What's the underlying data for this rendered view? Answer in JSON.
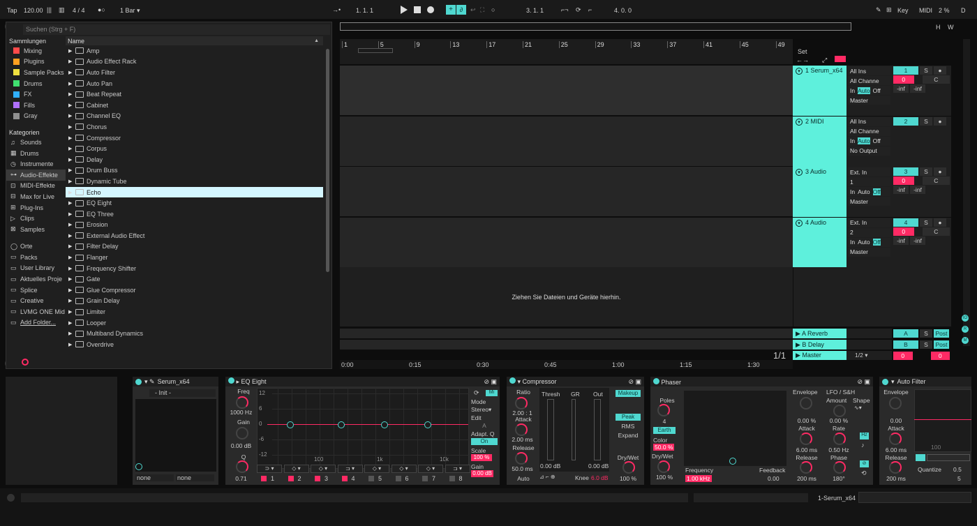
{
  "toolbar": {
    "tap": "Tap",
    "tempo": "120.00",
    "meter": "4 / 4",
    "quant": "1 Bar",
    "position": "1.   1.   1",
    "loop_start": "3.   1.   1",
    "loop_length": "4.   0.   0",
    "key": "Key",
    "midi": "MIDI",
    "cpu": "2 %",
    "d": "D",
    "h": "H",
    "w": "W"
  },
  "browser": {
    "search_placeholder": "Suchen (Strg + F)",
    "collections_title": "Sammlungen",
    "collections": [
      {
        "label": "Mixing",
        "color": "#ff4a4a"
      },
      {
        "label": "Plugins",
        "color": "#ffa020"
      },
      {
        "label": "Sample Packs",
        "color": "#f0e040"
      },
      {
        "label": "Drums",
        "color": "#40e070"
      },
      {
        "label": "FX",
        "color": "#30b0ff"
      },
      {
        "label": "Fills",
        "color": "#b070ff"
      },
      {
        "label": "Gray",
        "color": "#909090"
      }
    ],
    "categories_title": "Kategorien",
    "categories": [
      "Sounds",
      "Drums",
      "Instrumente",
      "Audio-Effekte",
      "MIDI-Effekte",
      "Max for Live",
      "Plug-Ins",
      "Clips",
      "Samples"
    ],
    "places_title": "Orte",
    "places": [
      "Packs",
      "User Library",
      "Aktuelles Proje",
      "Splice",
      "Creative",
      "LVMG ONE Mid",
      "Add Folder..."
    ],
    "list_header": "Name",
    "items": [
      "Amp",
      "Audio Effect Rack",
      "Auto Filter",
      "Auto Pan",
      "Beat Repeat",
      "Cabinet",
      "Channel EQ",
      "Chorus",
      "Compressor",
      "Corpus",
      "Delay",
      "Drum Buss",
      "Dynamic Tube",
      "Echo",
      "EQ Eight",
      "EQ Three",
      "Erosion",
      "External Audio Effect",
      "Filter Delay",
      "Flanger",
      "Frequency Shifter",
      "Gate",
      "Glue Compressor",
      "Grain Delay",
      "Limiter",
      "Looper",
      "Multiband Dynamics",
      "Overdrive"
    ]
  },
  "arrangement": {
    "bars": [
      "1",
      "5",
      "9",
      "13",
      "17",
      "21",
      "25",
      "29",
      "33",
      "37",
      "41",
      "45",
      "49"
    ],
    "times": [
      "0:00",
      "0:15",
      "0:30",
      "0:45",
      "1:00",
      "1:15",
      "1:30"
    ],
    "drop_hint": "Ziehen Sie Dateien und Geräte hierhin.",
    "set_label": "Set",
    "page": "1/1",
    "tracks": [
      {
        "name": "1 Serum_x64",
        "in": "All Ins",
        "ch": "All Channe",
        "mon_in": "In",
        "mon_auto": "Auto",
        "mon_off": "Off",
        "out": "Master",
        "num": "1",
        "vol": "0",
        "pan": "C",
        "peak1": "-inf",
        "peak2": "-inf"
      },
      {
        "name": "2 MIDI",
        "in": "All Ins",
        "ch": "All Channe",
        "mon_in": "In",
        "mon_auto": "Auto",
        "mon_off": "Off",
        "out": "No Output",
        "num": "2"
      },
      {
        "name": "3 Audio",
        "in": "Ext. In",
        "ch": "1",
        "mon_in": "In",
        "mon_auto": "Auto",
        "mon_off": "Off",
        "out": "Master",
        "num": "3",
        "vol": "0",
        "pan": "C",
        "peak1": "-inf",
        "peak2": "-inf"
      },
      {
        "name": "4 Audio",
        "in": "Ext. In",
        "ch": "2",
        "mon_in": "In",
        "mon_auto": "Auto",
        "mon_off": "Off",
        "out": "Master",
        "num": "4",
        "vol": "0",
        "pan": "C",
        "peak1": "-inf",
        "peak2": "-inf"
      }
    ],
    "returns": [
      {
        "name": "A Reverb",
        "btn": "A",
        "s": "S",
        "post": "Post"
      },
      {
        "name": "B Delay",
        "btn": "B",
        "s": "S",
        "post": "Post"
      }
    ],
    "master": {
      "name": "Master",
      "cue": "1/2",
      "vol": "0",
      "vol2": "0"
    }
  },
  "devices": {
    "serum": {
      "title": "Serum_x64",
      "preset": "- Init -",
      "left": "none",
      "right": "none"
    },
    "eq": {
      "title": "EQ Eight",
      "freq_label": "Freq",
      "freq": "1000 Hz",
      "gain_label": "Gain",
      "gain": "0.00 dB",
      "q_label": "Q",
      "q": "0.71",
      "db": [
        "12",
        "6",
        "0",
        "-6",
        "-12"
      ],
      "hz": [
        "100",
        "1k",
        "10k"
      ],
      "mode_label": "Mode",
      "mode": "Stereo",
      "edit": "Edit",
      "edit_val": "A",
      "adapt": "Adapt. Q",
      "adapt_val": "On",
      "scale": "Scale",
      "scale_val": "100 %",
      "gain2_label": "Gain",
      "gain2": "0.00 dB",
      "bands": [
        "1",
        "2",
        "3",
        "4",
        "5",
        "6",
        "7",
        "8"
      ],
      "mi": "Mi"
    },
    "comp": {
      "title": "Compressor",
      "ratio_label": "Ratio",
      "ratio": "2.00 : 1",
      "attack_label": "Attack",
      "attack": "2.00 ms",
      "release_label": "Release",
      "release": "50.0 ms",
      "auto": "Auto",
      "thresh": "Thresh",
      "gr": "GR",
      "out": "Out",
      "thresh_val": "0.00 dB",
      "out_val": "0.00 dB",
      "makeup": "Makeup",
      "peak": "Peak",
      "rms": "RMS",
      "expand": "Expand",
      "knee_label": "Knee",
      "knee": "6.0 dB",
      "drywet_label": "Dry/Wet",
      "drywet": "100 %"
    },
    "phaser": {
      "title": "Phaser",
      "poles_label": "Poles",
      "poles": "4",
      "earth": "Earth",
      "color_label": "Color",
      "color": "50.0 %",
      "drywet_label": "Dry/Wet",
      "drywet": "100 %",
      "freq_label": "Frequency",
      "freq": "1.00 kHz",
      "fb_label": "Feedback",
      "fb": "0.00",
      "env_label": "Envelope",
      "env": "0.00 %",
      "attack_label": "Attack",
      "attack": "6.00 ms",
      "release_label": "Release",
      "release": "200 ms",
      "lfo_label": "LFO / S&H",
      "amount_label": "Amount",
      "amount": "0.00 %",
      "shape_label": "Shape",
      "rate_label": "Rate",
      "rate": "0.50 Hz",
      "phase_label": "Phase",
      "phase": "180°",
      "hz": "Hz"
    },
    "autofilter": {
      "title": "Auto Filter",
      "env_label": "Envelope",
      "env": "0.00",
      "attack_label": "Attack",
      "attack": "6.00 ms",
      "release_label": "Release",
      "release": "200 ms",
      "quantize": "Quantize",
      "q_val": "0.5",
      "five": "5",
      "hundred": "100"
    }
  },
  "status": {
    "track": "1-Serum_x64"
  }
}
